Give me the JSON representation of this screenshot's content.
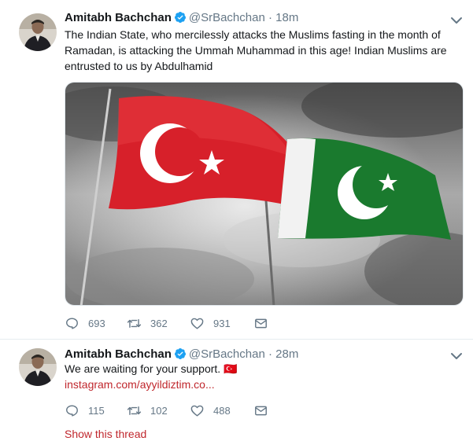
{
  "tweets": [
    {
      "name": "Amitabh Bachchan",
      "handle": "@SrBachchan",
      "separator": "·",
      "time": "18m",
      "text": "The Indian State, who mercilessly attacks the Muslims fasting in the month of Ramadan, is attacking the Ummah Muhammad in this age! Indian Muslims are entrusted to us by Abdulhamid",
      "replies": "693",
      "retweets": "362",
      "likes": "931"
    },
    {
      "name": "Amitabh Bachchan",
      "handle": "@SrBachchan",
      "separator": "·",
      "time": "28m",
      "text": "We are waiting for your support. 🇹🇷",
      "link": "instagram.com/ayyildiztim.co...",
      "replies": "115",
      "retweets": "102",
      "likes": "488",
      "show_thread": "Show this thread"
    }
  ],
  "colors": {
    "verified": "#1da1f2",
    "link": "#c0272d",
    "muted": "#657786"
  },
  "icons": [
    "verified-badge-icon",
    "chevron-down-icon",
    "reply-icon",
    "retweet-icon",
    "like-icon",
    "message-icon"
  ]
}
